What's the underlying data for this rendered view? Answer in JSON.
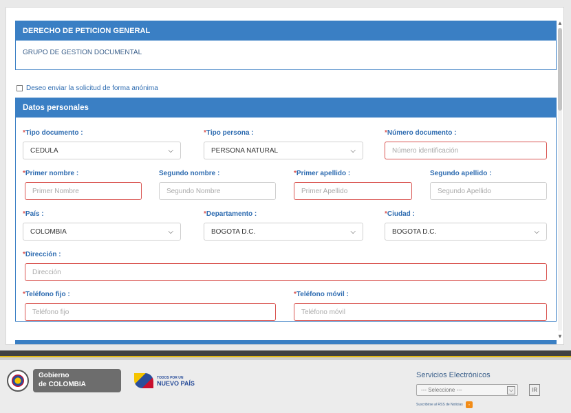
{
  "form": {
    "title": "DERECHO DE PETICION GENERAL",
    "subtitle": "GRUPO DE GESTION DOCUMENTAL",
    "anonymous_label": "Deseo enviar la solicitud de forma anónima",
    "personal": {
      "header": "Datos personales",
      "tipo_documento": {
        "label": "Tipo documento :",
        "value": "CEDULA"
      },
      "tipo_persona": {
        "label": "Tipo persona :",
        "value": "PERSONA NATURAL"
      },
      "numero_documento": {
        "label": "Número documento :",
        "placeholder": "Número identificación"
      },
      "primer_nombre": {
        "label": "Primer nombre :",
        "placeholder": "Primer Nombre"
      },
      "segundo_nombre": {
        "label": "Segundo nombre :",
        "placeholder": "Segundo Nombre"
      },
      "primer_apellido": {
        "label": "Primer apellido :",
        "placeholder": "Primer Apellido"
      },
      "segundo_apellido": {
        "label": "Segundo apellido :",
        "placeholder": "Segundo Apellido"
      },
      "pais": {
        "label": "País :",
        "value": "COLOMBIA"
      },
      "departamento": {
        "label": "Departamento :",
        "value": "BOGOTA D.C."
      },
      "ciudad": {
        "label": "Ciudad :",
        "value": "BOGOTA D.C."
      },
      "direccion": {
        "label": "Dirección :",
        "placeholder": "Dirección"
      },
      "telefono_fijo": {
        "label": "Teléfono fijo :",
        "placeholder": "Teléfono fijo"
      },
      "telefono_movil": {
        "label": "Teléfono móvil :",
        "placeholder": "Teléfono móvil"
      }
    },
    "required_mark": "*"
  },
  "footer": {
    "gov_logo_line1": "Gobierno",
    "gov_logo_line2": "de COLOMBIA",
    "nuevo_line1": "TODOS POR UN",
    "nuevo_line2": "NUEVO PAÍS",
    "services_title": "Servicios Electrónicos",
    "services_select": "--- Seleccione ---",
    "go_label": "IR",
    "rss_label": "Suscribirse al RSS de Noticias"
  },
  "colors": {
    "panel_blue": "#3a7fc4",
    "label_blue": "#2d6bb0",
    "required_red": "#d9534f",
    "footer_dark": "#414141",
    "footer_yellow": "#e3b814"
  }
}
